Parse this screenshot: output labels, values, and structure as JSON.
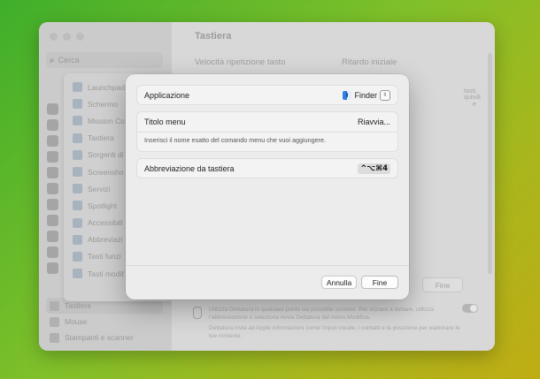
{
  "window": {
    "title": "Tastiera",
    "search_placeholder": "Cerca"
  },
  "sidebar": {
    "submenu_items": [
      "Launchpad",
      "Schermo",
      "Mission Co",
      "Tastiera",
      "Sorgenti di",
      "Screensho",
      "Servizi",
      "Spotlight",
      "Accessibili",
      "Abbreviazi",
      "Tasti funzi",
      "Tasti modif"
    ],
    "bottom_items": [
      "Tastiera",
      "Mouse",
      "Stampanti e scanner"
    ]
  },
  "main": {
    "row_left": "Velocità ripetizione tasto",
    "row_right": "Ritardo iniziale",
    "frag1": "tasti, quindi",
    "frag2": "e",
    "fine_label": "Fine",
    "dictation_text1": "Utilizza Dettatura in qualsiasi punto sia possibile scrivere. Per iniziare a dettare, utilizza l'abbreviazione o seleziona Avvia Dettatura dal menu Modifica.",
    "dictation_text2": "Dettatura invia ad Apple informazioni come l'input vocale, i contatti e la posizione per elaborare le tue richieste."
  },
  "dialog": {
    "app_label": "Applicazione",
    "app_value": "Finder",
    "menu_title_label": "Titolo menu",
    "menu_title_value": "Riavvia...",
    "hint": "Inserisci il nome esatto del comando menu che vuoi aggiungere.",
    "shortcut_label": "Abbreviazione da tastiera",
    "shortcut_value": "^⌥⌘4",
    "cancel_label": "Annulla",
    "done_label": "Fine"
  }
}
